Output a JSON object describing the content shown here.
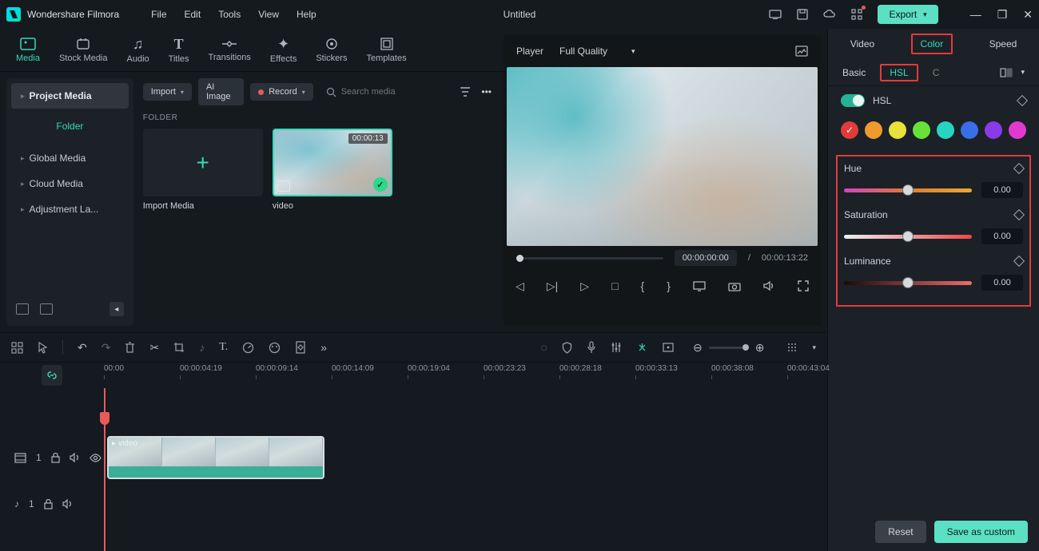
{
  "app": {
    "name": "Wondershare Filmora",
    "document": "Untitled"
  },
  "menus": [
    "File",
    "Edit",
    "Tools",
    "View",
    "Help"
  ],
  "export_label": "Export",
  "nav": [
    {
      "label": "Media",
      "icon": "▢"
    },
    {
      "label": "Stock Media",
      "icon": "☁"
    },
    {
      "label": "Audio",
      "icon": "♪"
    },
    {
      "label": "Titles",
      "icon": "T"
    },
    {
      "label": "Transitions",
      "icon": "⇄"
    },
    {
      "label": "Effects",
      "icon": "✦"
    },
    {
      "label": "Stickers",
      "icon": "◉"
    },
    {
      "label": "Templates",
      "icon": "▣"
    }
  ],
  "sidebar": {
    "project_media": "Project Media",
    "folder": "Folder",
    "items": [
      "Global Media",
      "Cloud Media",
      "Adjustment La..."
    ]
  },
  "browser": {
    "import": "Import",
    "ai_image": "AI Image",
    "record": "Record",
    "search_placeholder": "Search media",
    "folder_label": "FOLDER",
    "import_media_label": "Import Media",
    "clip": {
      "name": "video",
      "duration": "00:00:13"
    }
  },
  "player": {
    "label": "Player",
    "quality": "Full Quality",
    "current": "00:00:00:00",
    "total": "00:00:13:22",
    "sep": "/"
  },
  "timeline": {
    "ticks": [
      "00:00",
      "00:00:04:19",
      "00:00:09:14",
      "00:00:14:09",
      "00:00:19:04",
      "00:00:23:23",
      "00:00:28:18",
      "00:00:33:13",
      "00:00:38:08",
      "00:00:43:04"
    ],
    "video_track": "1",
    "audio_track": "1",
    "clip_label": "video"
  },
  "inspector": {
    "tabs": [
      "Video",
      "Color",
      "Speed"
    ],
    "subtabs": {
      "basic": "Basic",
      "hsl": "HSL",
      "c": "C"
    },
    "hsl_label": "HSL",
    "swatches": [
      "#e23b3b",
      "#ef9a2f",
      "#e8e23a",
      "#68e23a",
      "#29d3c2",
      "#3a6de8",
      "#8a3ae8",
      "#e23ad0"
    ],
    "params": {
      "hue": {
        "label": "Hue",
        "value": "0.00"
      },
      "saturation": {
        "label": "Saturation",
        "value": "0.00"
      },
      "luminance": {
        "label": "Luminance",
        "value": "0.00"
      }
    },
    "reset": "Reset",
    "save": "Save as custom"
  }
}
